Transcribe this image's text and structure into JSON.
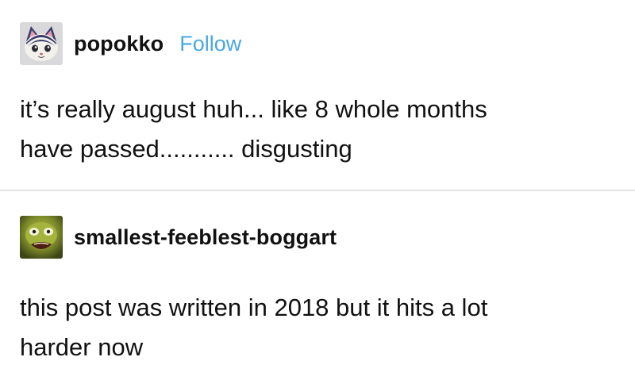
{
  "posts": [
    {
      "avatar_icon": "cat-villager-avatar-icon",
      "username": "popokko",
      "follow_label": "Follow",
      "text": "it’s really august huh... like 8 whole months\nhave passed........... disgusting"
    },
    {
      "avatar_icon": "green-creature-avatar-icon",
      "username": "smallest-feeblest-boggart",
      "text": "this post was written in 2018 but it hits a lot\nharder now"
    }
  ],
  "colors": {
    "follow_link": "#4aa8e0",
    "divider": "#e4e4e4",
    "text": "#111111"
  }
}
